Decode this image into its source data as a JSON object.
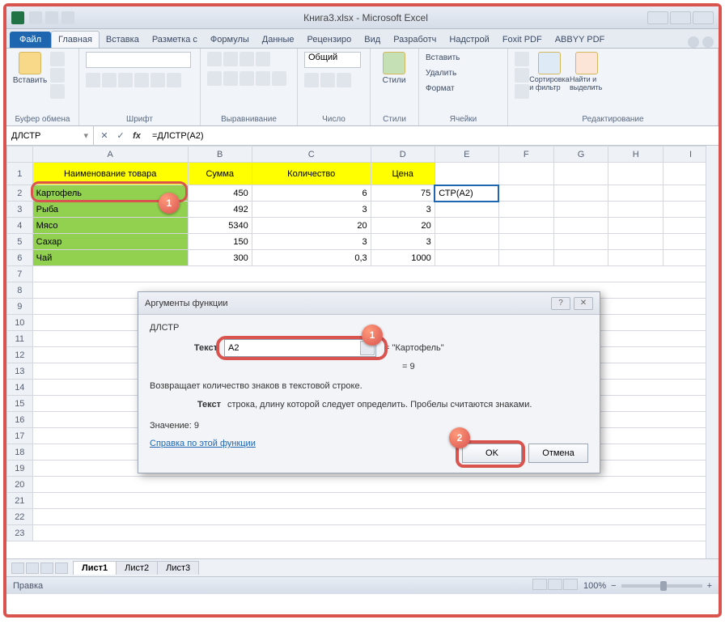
{
  "window": {
    "title": "Книга3.xlsx - Microsoft Excel"
  },
  "ribbon_tabs": {
    "file": "Файл",
    "items": [
      "Главная",
      "Вставка",
      "Разметка с",
      "Формулы",
      "Данные",
      "Рецензиро",
      "Вид",
      "Разработч",
      "Надстрой",
      "Foxit PDF",
      "ABBYY PDF"
    ]
  },
  "ribbon_groups": {
    "paste": "Вставить",
    "clipboard": "Буфер обмена",
    "font": "Шрифт",
    "alignment": "Выравнивание",
    "number": "Число",
    "number_format": "Общий",
    "styles": "Стили",
    "styles_btn": "Стили",
    "cells": "Ячейки",
    "cells_insert": "Вставить",
    "cells_delete": "Удалить",
    "cells_format": "Формат",
    "editing": "Редактирование",
    "sort": "Сортировка и фильтр",
    "find": "Найти и выделить"
  },
  "formula_bar": {
    "name_box": "ДЛСТР",
    "formula": "=ДЛСТР(A2)"
  },
  "columns": [
    "A",
    "B",
    "C",
    "D",
    "E",
    "F",
    "G",
    "H",
    "I"
  ],
  "headers": {
    "name": "Наименование товара",
    "sum": "Сумма",
    "qty": "Количество",
    "price": "Цена"
  },
  "rows": [
    {
      "n": "Картофель",
      "s": "450",
      "q": "6",
      "p": "75"
    },
    {
      "n": "Рыба",
      "s": "492",
      "q": "3",
      "p": "3"
    },
    {
      "n": "Мясо",
      "s": "5340",
      "q": "20",
      "p": "20"
    },
    {
      "n": "Сахар",
      "s": "150",
      "q": "3",
      "p": "3"
    },
    {
      "n": "Чай",
      "s": "300",
      "q": "0,3",
      "p": "1000"
    }
  ],
  "e2": "СТР(A2)",
  "dialog": {
    "title": "Аргументы функции",
    "func": "ДЛСТР",
    "arg_label": "Текст",
    "arg_value": "A2",
    "arg_eval": "= \"Картофель\"",
    "result_eval": "= 9",
    "desc": "Возвращает количество знаков в текстовой строке.",
    "param_name": "Текст",
    "param_desc": "строка, длину которой следует определить. Пробелы считаются знаками.",
    "value_label": "Значение:",
    "value": "9",
    "help_link": "Справка по этой функции",
    "ok": "OK",
    "cancel": "Отмена"
  },
  "sheets": [
    "Лист1",
    "Лист2",
    "Лист3"
  ],
  "status": {
    "mode": "Правка",
    "zoom": "100%"
  },
  "callouts": {
    "one": "1",
    "two": "2"
  }
}
